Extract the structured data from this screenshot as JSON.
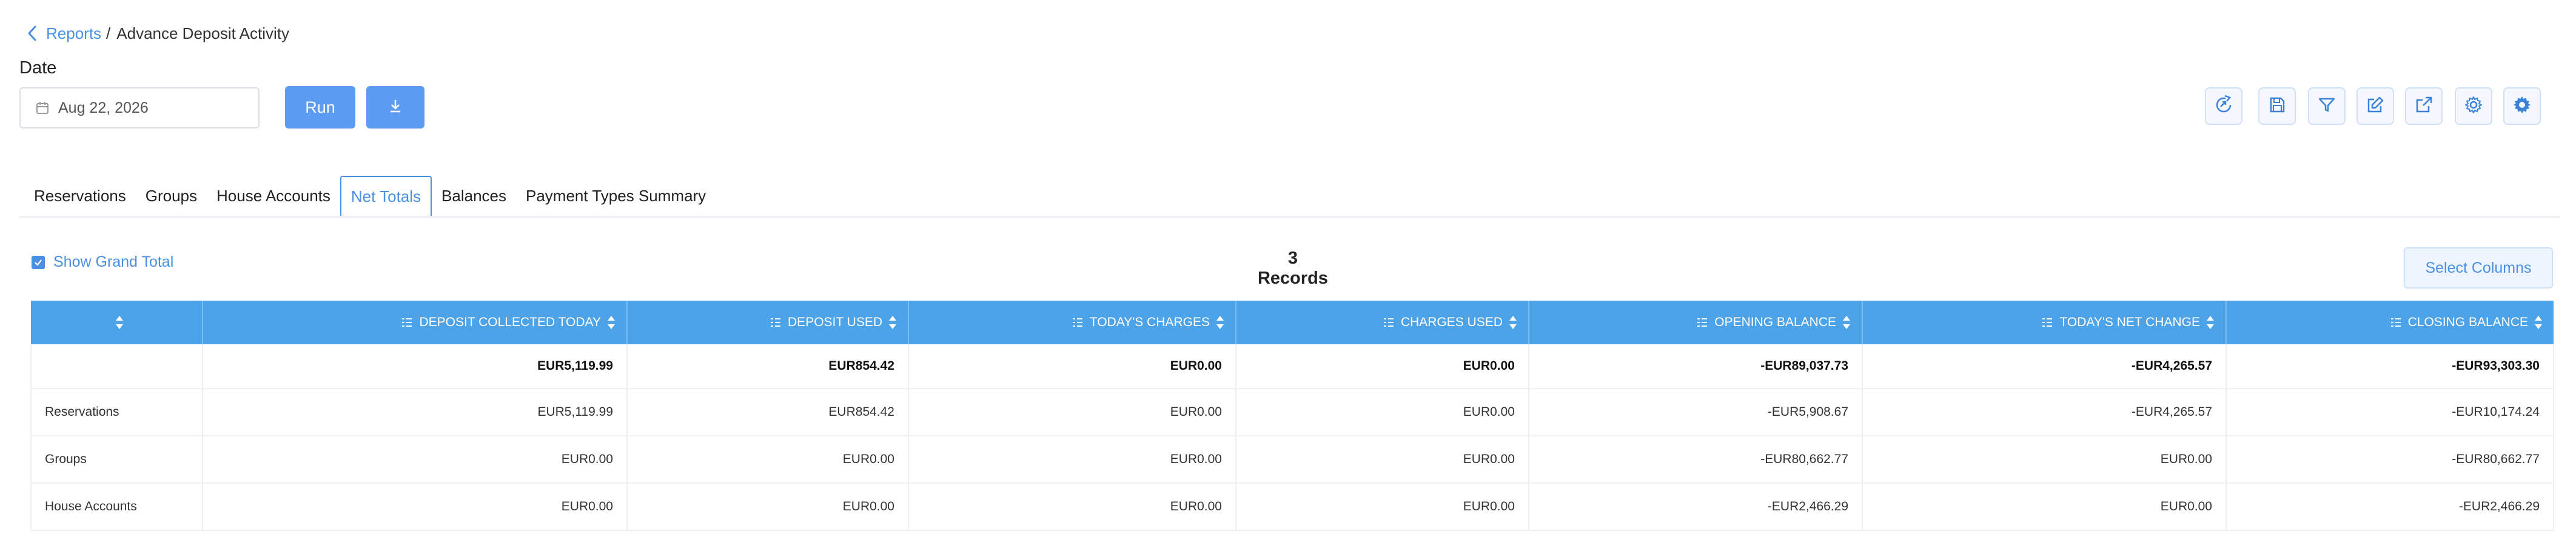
{
  "breadcrumb": {
    "parent": "Reports",
    "separator": "/",
    "current": "Advance Deposit Activity"
  },
  "filters": {
    "date_label": "Date",
    "date_value": "Aug 22, 2026"
  },
  "actions": {
    "run_label": "Run"
  },
  "tabs": [
    {
      "label": "Reservations"
    },
    {
      "label": "Groups"
    },
    {
      "label": "House Accounts"
    },
    {
      "label": "Net Totals",
      "active": true
    },
    {
      "label": "Balances"
    },
    {
      "label": "Payment Types Summary"
    }
  ],
  "grand_total_label": "Show Grand Total",
  "records_label": "3 Records",
  "select_columns_label": "Select Columns",
  "table": {
    "columns": [
      "",
      "DEPOSIT COLLECTED TODAY",
      "DEPOSIT USED",
      "TODAY'S CHARGES",
      "CHARGES USED",
      "OPENING BALANCE",
      "TODAY'S NET CHANGE",
      "CLOSING BALANCE"
    ],
    "total_row": [
      "",
      "EUR5,119.99",
      "EUR854.42",
      "EUR0.00",
      "EUR0.00",
      "-EUR89,037.73",
      "-EUR4,265.57",
      "-EUR93,303.30"
    ],
    "rows": [
      [
        "Reservations",
        "EUR5,119.99",
        "EUR854.42",
        "EUR0.00",
        "EUR0.00",
        "-EUR5,908.67",
        "-EUR4,265.57",
        "-EUR10,174.24"
      ],
      [
        "Groups",
        "EUR0.00",
        "EUR0.00",
        "EUR0.00",
        "EUR0.00",
        "-EUR80,662.77",
        "EUR0.00",
        "-EUR80,662.77"
      ],
      [
        "House Accounts",
        "EUR0.00",
        "EUR0.00",
        "EUR0.00",
        "EUR0.00",
        "-EUR2,466.29",
        "EUR0.00",
        "-EUR2,466.29"
      ]
    ]
  },
  "colors": {
    "accent": "#4a90e2",
    "header": "#4da3e8",
    "button": "#5b9cf2"
  },
  "icons": [
    "chevron-left-icon",
    "calendar-icon",
    "download-icon",
    "refresh-report-icon",
    "save-icon",
    "filter-icon",
    "edit-icon",
    "export-icon",
    "settings-icon",
    "advanced-settings-icon",
    "checkbox-icon",
    "sort-icon",
    "column-lines-icon"
  ]
}
